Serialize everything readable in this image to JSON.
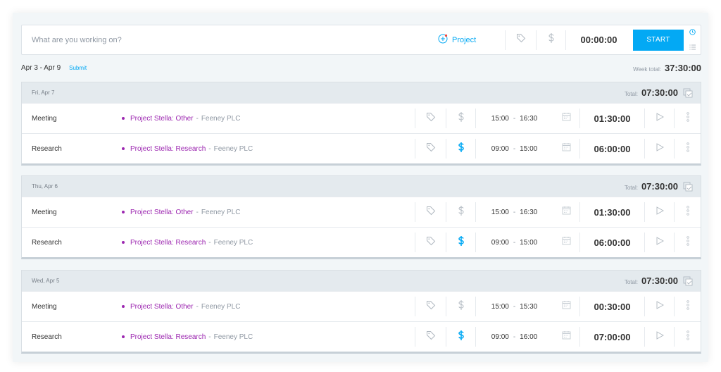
{
  "timer": {
    "placeholder": "What are you working on?",
    "project_label": "Project",
    "time": "00:00:00",
    "start_label": "START"
  },
  "week": {
    "range": "Apr 3 - Apr 9",
    "submit_label": "Submit",
    "total_label": "Week total:",
    "total_value": "37:30:00"
  },
  "days": [
    {
      "label": "Fri, Apr 7",
      "total_label": "Total:",
      "total_value": "07:30:00",
      "entries": [
        {
          "description": "Meeting",
          "project": "Project Stella: Other",
          "separator": "-",
          "client": "Feeney PLC",
          "billable": false,
          "start": "15:00",
          "dash": "-",
          "end": "16:30",
          "duration": "01:30:00"
        },
        {
          "description": "Research",
          "project": "Project Stella: Research",
          "separator": "-",
          "client": "Feeney PLC",
          "billable": true,
          "start": "09:00",
          "dash": "-",
          "end": "15:00",
          "duration": "06:00:00"
        }
      ]
    },
    {
      "label": "Thu, Apr 6",
      "total_label": "Total:",
      "total_value": "07:30:00",
      "entries": [
        {
          "description": "Meeting",
          "project": "Project Stella: Other",
          "separator": "-",
          "client": "Feeney PLC",
          "billable": false,
          "start": "15:00",
          "dash": "-",
          "end": "16:30",
          "duration": "01:30:00"
        },
        {
          "description": "Research",
          "project": "Project Stella: Research",
          "separator": "-",
          "client": "Feeney PLC",
          "billable": true,
          "start": "09:00",
          "dash": "-",
          "end": "15:00",
          "duration": "06:00:00"
        }
      ]
    },
    {
      "label": "Wed, Apr 5",
      "total_label": "Total:",
      "total_value": "07:30:00",
      "entries": [
        {
          "description": "Meeting",
          "project": "Project Stella: Other",
          "separator": "-",
          "client": "Feeney PLC",
          "billable": false,
          "start": "15:00",
          "dash": "-",
          "end": "15:30",
          "duration": "00:30:00"
        },
        {
          "description": "Research",
          "project": "Project Stella: Research",
          "separator": "-",
          "client": "Feeney PLC",
          "billable": true,
          "start": "09:00",
          "dash": "-",
          "end": "16:00",
          "duration": "07:00:00"
        }
      ]
    }
  ],
  "colors": {
    "accent": "#03a9f4",
    "project": "#9c27b0",
    "muted": "#8f98a3",
    "billable_on": "#03a9f4",
    "billable_off": "#b0b8c0"
  },
  "icons": {
    "add_project": "plus-circle-icon",
    "tag": "tag-icon",
    "billable": "dollar-icon",
    "clock_mode": "clock-icon",
    "list_mode": "list-icon",
    "calendar": "calendar-icon",
    "bulk_edit": "bulk-edit-icon",
    "play": "play-icon",
    "more": "more-vertical-icon"
  }
}
